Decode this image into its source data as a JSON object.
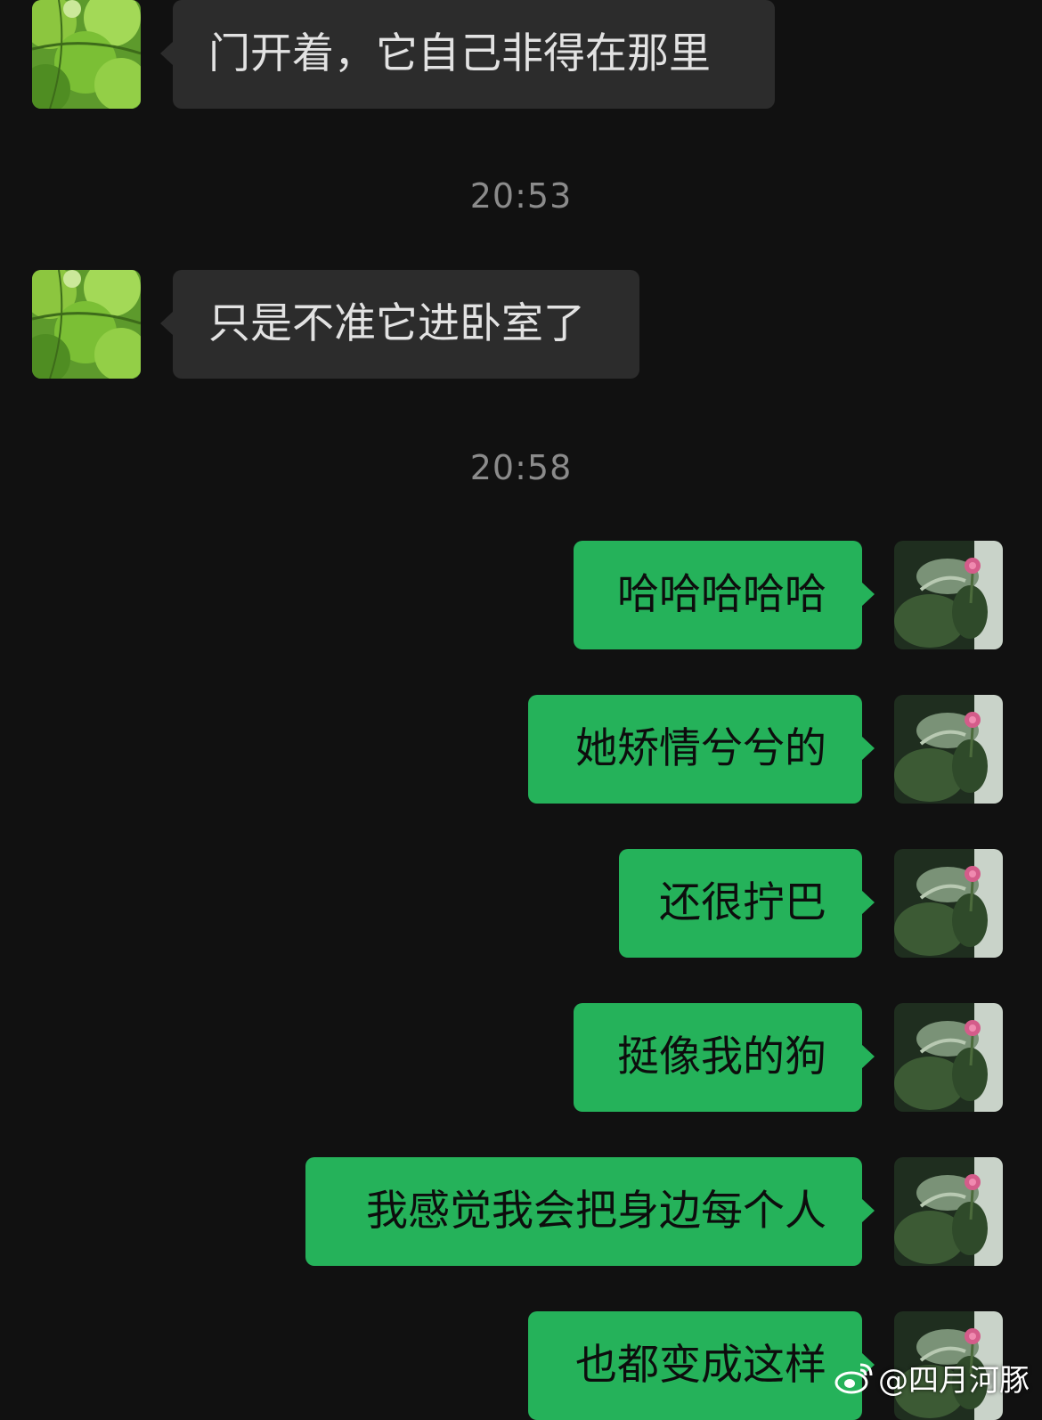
{
  "chat": {
    "messages": [
      {
        "side": "incoming",
        "text": "门开着，它自己非得在那里"
      },
      {
        "type": "timestamp",
        "text": "20:53"
      },
      {
        "side": "incoming",
        "text": "只是不准它进卧室了"
      },
      {
        "type": "timestamp",
        "text": "20:58"
      },
      {
        "side": "outgoing",
        "text": "哈哈哈哈哈"
      },
      {
        "side": "outgoing",
        "text": "她矫情兮兮的"
      },
      {
        "side": "outgoing",
        "text": "还很拧巴"
      },
      {
        "side": "outgoing",
        "text": "挺像我的狗"
      },
      {
        "side": "outgoing",
        "text": "我感觉我会把身边每个人"
      },
      {
        "side": "outgoing",
        "text": "也都变成这样"
      }
    ]
  },
  "avatars": {
    "contact_icon": "green-leaves-avatar-icon",
    "self_icon": "flower-leaves-avatar-icon"
  },
  "watermark": {
    "icon": "weibo-logo-icon",
    "text": "@四月河豚"
  },
  "colors": {
    "background": "#111111",
    "incoming_bubble": "#2c2c2c",
    "outgoing_bubble": "#25b25a",
    "timestamp": "#8b8b8b"
  }
}
